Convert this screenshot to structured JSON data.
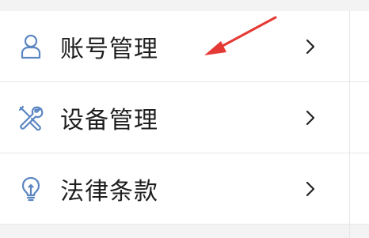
{
  "menu": {
    "items": [
      {
        "label": "账号管理",
        "icon": "user-icon"
      },
      {
        "label": "设备管理",
        "icon": "tools-icon"
      },
      {
        "label": "法律条款",
        "icon": "lightbulb-icon"
      }
    ]
  },
  "colors": {
    "icon": "#5b86c2",
    "text": "#1f1f1f",
    "annotation_arrow": "#e53935"
  }
}
